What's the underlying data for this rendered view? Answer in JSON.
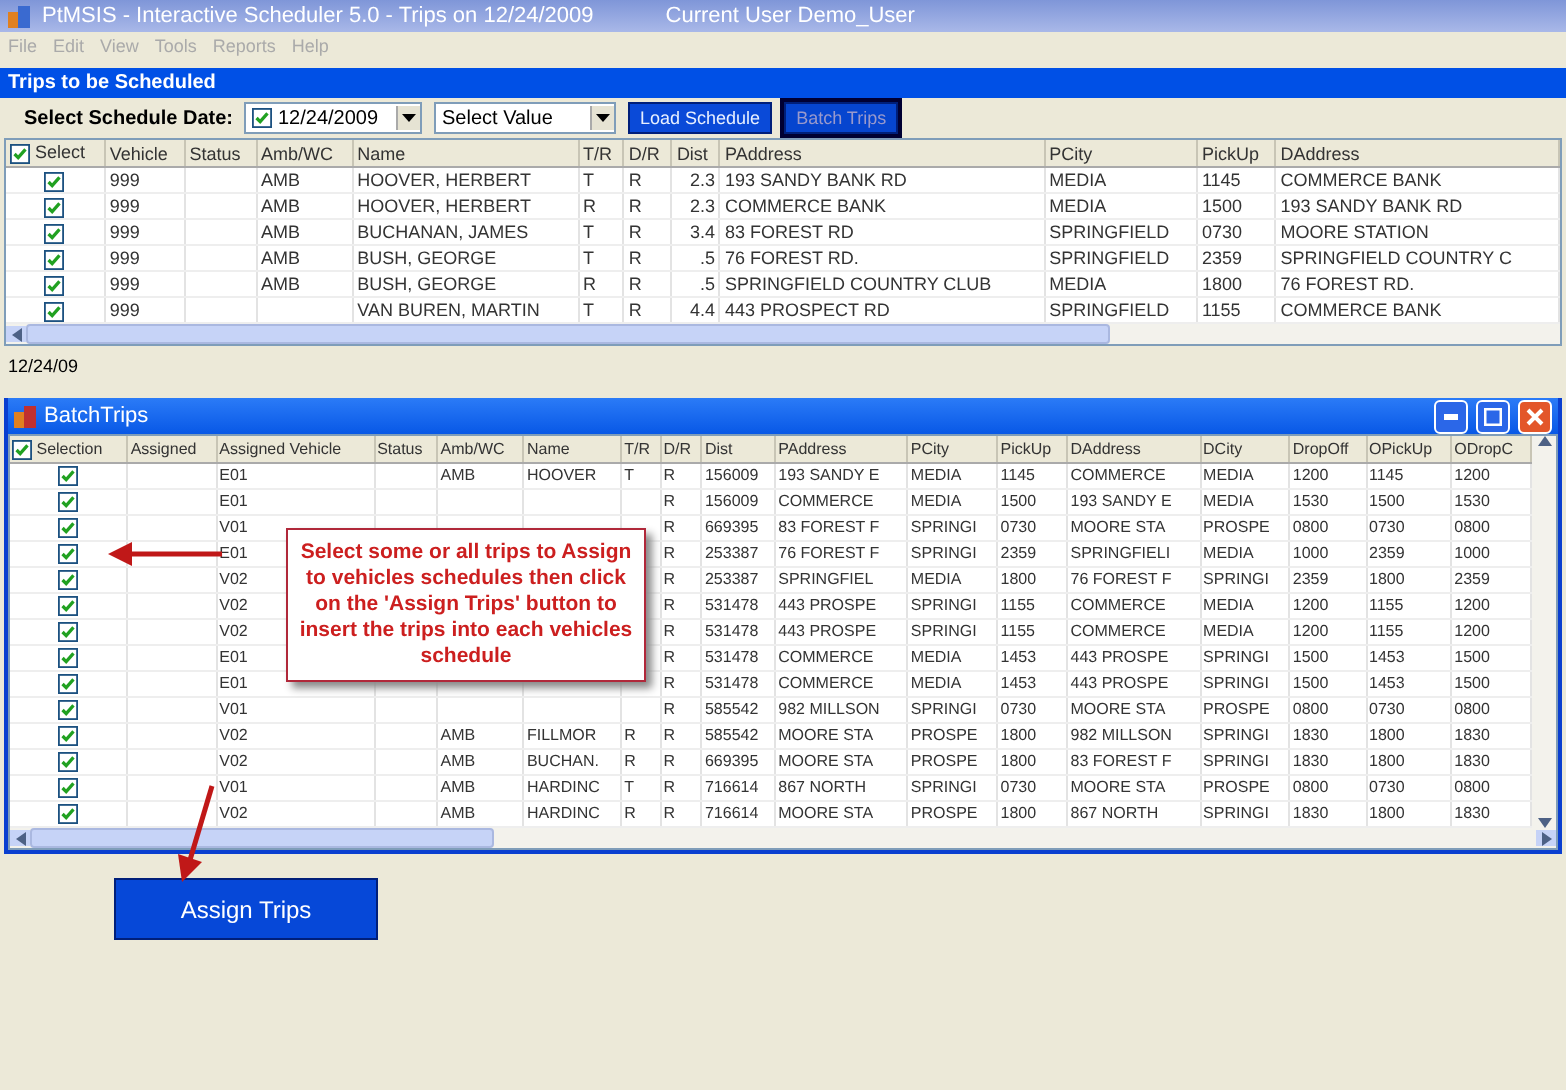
{
  "window": {
    "title": "PtMSIS - Interactive Scheduler 5.0 - Trips on 12/24/2009",
    "current_user": "Current User  Demo_User"
  },
  "menu": [
    "File",
    "Edit",
    "View",
    "Tools",
    "Reports",
    "Help"
  ],
  "panel": {
    "title": "Trips to be Scheduled",
    "date_label": "Select Schedule Date:",
    "date_field": {
      "value": "12/24/2009",
      "checked": true
    },
    "select_field": {
      "value": "Select Value"
    },
    "buttons": [
      {
        "label": "Load Schedule",
        "selected": false
      },
      {
        "label": "Batch Trips",
        "selected": true
      }
    ]
  },
  "trips_table": {
    "select_column": {
      "label": "Select",
      "checked": true
    },
    "columns": [
      "Vehicle",
      "Status",
      "Amb/WC",
      "Name",
      "T/R",
      "D/R",
      "Dist",
      "PAddress",
      "PCity",
      "PickUp",
      "DAddress"
    ],
    "rows": [
      {
        "checked": true,
        "cells": [
          "999",
          "",
          "AMB",
          "HOOVER, HERBERT",
          "T",
          "R",
          "2.3",
          "193 SANDY BANK RD",
          "MEDIA",
          "1145",
          "COMMERCE BANK"
        ]
      },
      {
        "checked": true,
        "cells": [
          "999",
          "",
          "AMB",
          "HOOVER, HERBERT",
          "R",
          "R",
          "2.3",
          "COMMERCE BANK",
          "MEDIA",
          "1500",
          "193 SANDY BANK RD"
        ]
      },
      {
        "checked": true,
        "cells": [
          "999",
          "",
          "AMB",
          "BUCHANAN, JAMES",
          "T",
          "R",
          "3.4",
          "83 FOREST RD",
          "SPRINGFIELD",
          "0730",
          "MOORE STATION"
        ]
      },
      {
        "checked": true,
        "cells": [
          "999",
          "",
          "AMB",
          "BUSH, GEORGE",
          "T",
          "R",
          ".5",
          "76 FOREST RD.",
          "SPRINGFIELD",
          "2359",
          "SPRINGFIELD COUNTRY C"
        ]
      },
      {
        "checked": true,
        "cells": [
          "999",
          "",
          "AMB",
          "BUSH, GEORGE",
          "R",
          "R",
          ".5",
          "SPRINGFIELD COUNTRY CLUB",
          "MEDIA",
          "1800",
          "76 FOREST RD."
        ]
      },
      {
        "checked": true,
        "cells": [
          "999",
          "",
          "",
          "VAN BUREN, MARTIN",
          "T",
          "R",
          "4.4",
          "443 PROSPECT RD",
          "SPRINGFIELD",
          "1155",
          "COMMERCE BANK"
        ]
      }
    ]
  },
  "status_text": "12/24/09",
  "batch_window": {
    "title": "BatchTrips",
    "table": {
      "select_column": {
        "label": "Selection",
        "checked": true
      },
      "columns": [
        "Assigned",
        "Assigned Vehicle",
        "Status",
        "Amb/WC",
        "Name",
        "T/R",
        "D/R",
        "Dist",
        "PAddress",
        "PCity",
        "PickUp",
        "DAddress",
        "DCity",
        "DropOff",
        "OPickUp",
        "ODropC"
      ],
      "rows": [
        {
          "checked": true,
          "cells": [
            "",
            "E01",
            "",
            "AMB",
            "HOOVER",
            "T",
            "R",
            "156009",
            "193 SANDY E",
            "MEDIA",
            "1145",
            "COMMERCE",
            "MEDIA",
            "1200",
            "1145",
            "1200"
          ]
        },
        {
          "checked": true,
          "cells": [
            "",
            "E01",
            "",
            "",
            "",
            "",
            "R",
            "156009",
            "COMMERCE",
            "MEDIA",
            "1500",
            "193 SANDY E",
            "MEDIA",
            "1530",
            "1500",
            "1530"
          ]
        },
        {
          "checked": true,
          "cells": [
            "",
            "V01",
            "",
            "",
            "",
            "",
            "R",
            "669395",
            "83 FOREST F",
            "SPRINGI",
            "0730",
            "MOORE STA",
            "PROSPE",
            "0800",
            "0730",
            "0800"
          ]
        },
        {
          "checked": true,
          "cells": [
            "",
            "E01",
            "",
            "",
            "",
            "",
            "R",
            "253387",
            "76 FOREST F",
            "SPRINGI",
            "2359",
            "SPRINGFIELI",
            "MEDIA",
            "1000",
            "2359",
            "1000"
          ]
        },
        {
          "checked": true,
          "cells": [
            "",
            "V02",
            "",
            "",
            "",
            "",
            "R",
            "253387",
            "SPRINGFIEL",
            "MEDIA",
            "1800",
            "76 FOREST F",
            "SPRINGI",
            "2359",
            "1800",
            "2359"
          ]
        },
        {
          "checked": true,
          "cells": [
            "",
            "V02",
            "",
            "",
            "",
            "",
            "R",
            "531478",
            "443 PROSPE",
            "SPRINGI",
            "1155",
            "COMMERCE",
            "MEDIA",
            "1200",
            "1155",
            "1200"
          ]
        },
        {
          "checked": true,
          "cells": [
            "",
            "V02",
            "",
            "",
            "",
            "",
            "R",
            "531478",
            "443 PROSPE",
            "SPRINGI",
            "1155",
            "COMMERCE",
            "MEDIA",
            "1200",
            "1155",
            "1200"
          ]
        },
        {
          "checked": true,
          "cells": [
            "",
            "E01",
            "",
            "",
            "",
            "",
            "R",
            "531478",
            "COMMERCE",
            "MEDIA",
            "1453",
            "443 PROSPE",
            "SPRINGI",
            "1500",
            "1453",
            "1500"
          ]
        },
        {
          "checked": true,
          "cells": [
            "",
            "E01",
            "",
            "",
            "",
            "",
            "R",
            "531478",
            "COMMERCE",
            "MEDIA",
            "1453",
            "443 PROSPE",
            "SPRINGI",
            "1500",
            "1453",
            "1500"
          ]
        },
        {
          "checked": true,
          "cells": [
            "",
            "V01",
            "",
            "",
            "",
            "",
            "R",
            "585542",
            "982 MILLSON",
            "SPRINGI",
            "0730",
            "MOORE STA",
            "PROSPE",
            "0800",
            "0730",
            "0800"
          ]
        },
        {
          "checked": true,
          "cells": [
            "",
            "V02",
            "",
            "AMB",
            "FILLMOR",
            "R",
            "R",
            "585542",
            "MOORE STA",
            "PROSPE",
            "1800",
            "982 MILLSON",
            "SPRINGI",
            "1830",
            "1800",
            "1830"
          ]
        },
        {
          "checked": true,
          "cells": [
            "",
            "V02",
            "",
            "AMB",
            "BUCHAN.",
            "R",
            "R",
            "669395",
            "MOORE STA",
            "PROSPE",
            "1800",
            "83 FOREST F",
            "SPRINGI",
            "1830",
            "1800",
            "1830"
          ]
        },
        {
          "checked": true,
          "cells": [
            "",
            "V01",
            "",
            "AMB",
            "HARDINC",
            "T",
            "R",
            "716614",
            "867 NORTH",
            "SPRINGI",
            "0730",
            "MOORE STA",
            "PROSPE",
            "0800",
            "0730",
            "0800"
          ]
        },
        {
          "checked": true,
          "cells": [
            "",
            "V02",
            "",
            "AMB",
            "HARDINC",
            "R",
            "R",
            "716614",
            "MOORE STA",
            "PROSPE",
            "1800",
            "867 NORTH",
            "SPRINGI",
            "1830",
            "1800",
            "1830"
          ]
        }
      ]
    },
    "callout": "Select some or all trips to Assign to vehicles schedules then click on the 'Assign Trips' button to insert the trips into each vehicles schedule",
    "assign_button": "Assign Trips"
  }
}
